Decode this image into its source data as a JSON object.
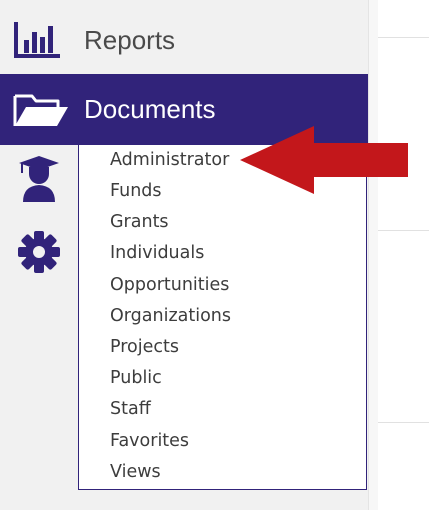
{
  "sidebar": {
    "reports": {
      "label": "Reports",
      "icon": "bar-chart-icon"
    },
    "documents": {
      "label": "Documents",
      "icon": "folder-open-icon"
    },
    "icons": [
      "graduate-user-icon",
      "gear-icon"
    ]
  },
  "submenu": {
    "items": [
      "Administrator",
      "Funds",
      "Grants",
      "Individuals",
      "Opportunities",
      "Organizations",
      "Projects",
      "Public",
      "Staff",
      "Favorites",
      "Views"
    ]
  },
  "annotation": {
    "icon": "red-arrow-icon",
    "color": "#c3171b"
  },
  "colors": {
    "brand": "#31237a",
    "sidebar_bg": "#f1f1f1"
  }
}
